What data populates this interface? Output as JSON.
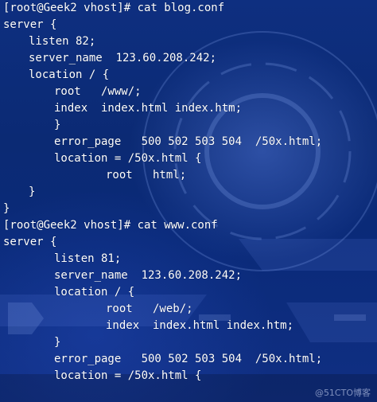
{
  "terminal": {
    "lines": [
      "[root@Geek2 vhost]# cat blog.conf",
      "server {",
      "listen 82;",
      "server_name  123.60.208.242;",
      "location / {",
      "root   /www/;",
      "index  index.html index.htm;",
      "}",
      "error_page   500 502 503 504  /50x.html;",
      "location = /50x.html {",
      "root   html;",
      "}",
      "}",
      "[root@Geek2 vhost]# cat www.conf",
      "server {",
      "listen 81;",
      "server_name  123.60.208.242;",
      "location / {",
      "root   /web/;",
      "index  index.html index.htm;",
      "}",
      "error_page   500 502 503 504  /50x.html;",
      "location = /50x.html {"
    ]
  },
  "watermark": "@51CTO博客"
}
